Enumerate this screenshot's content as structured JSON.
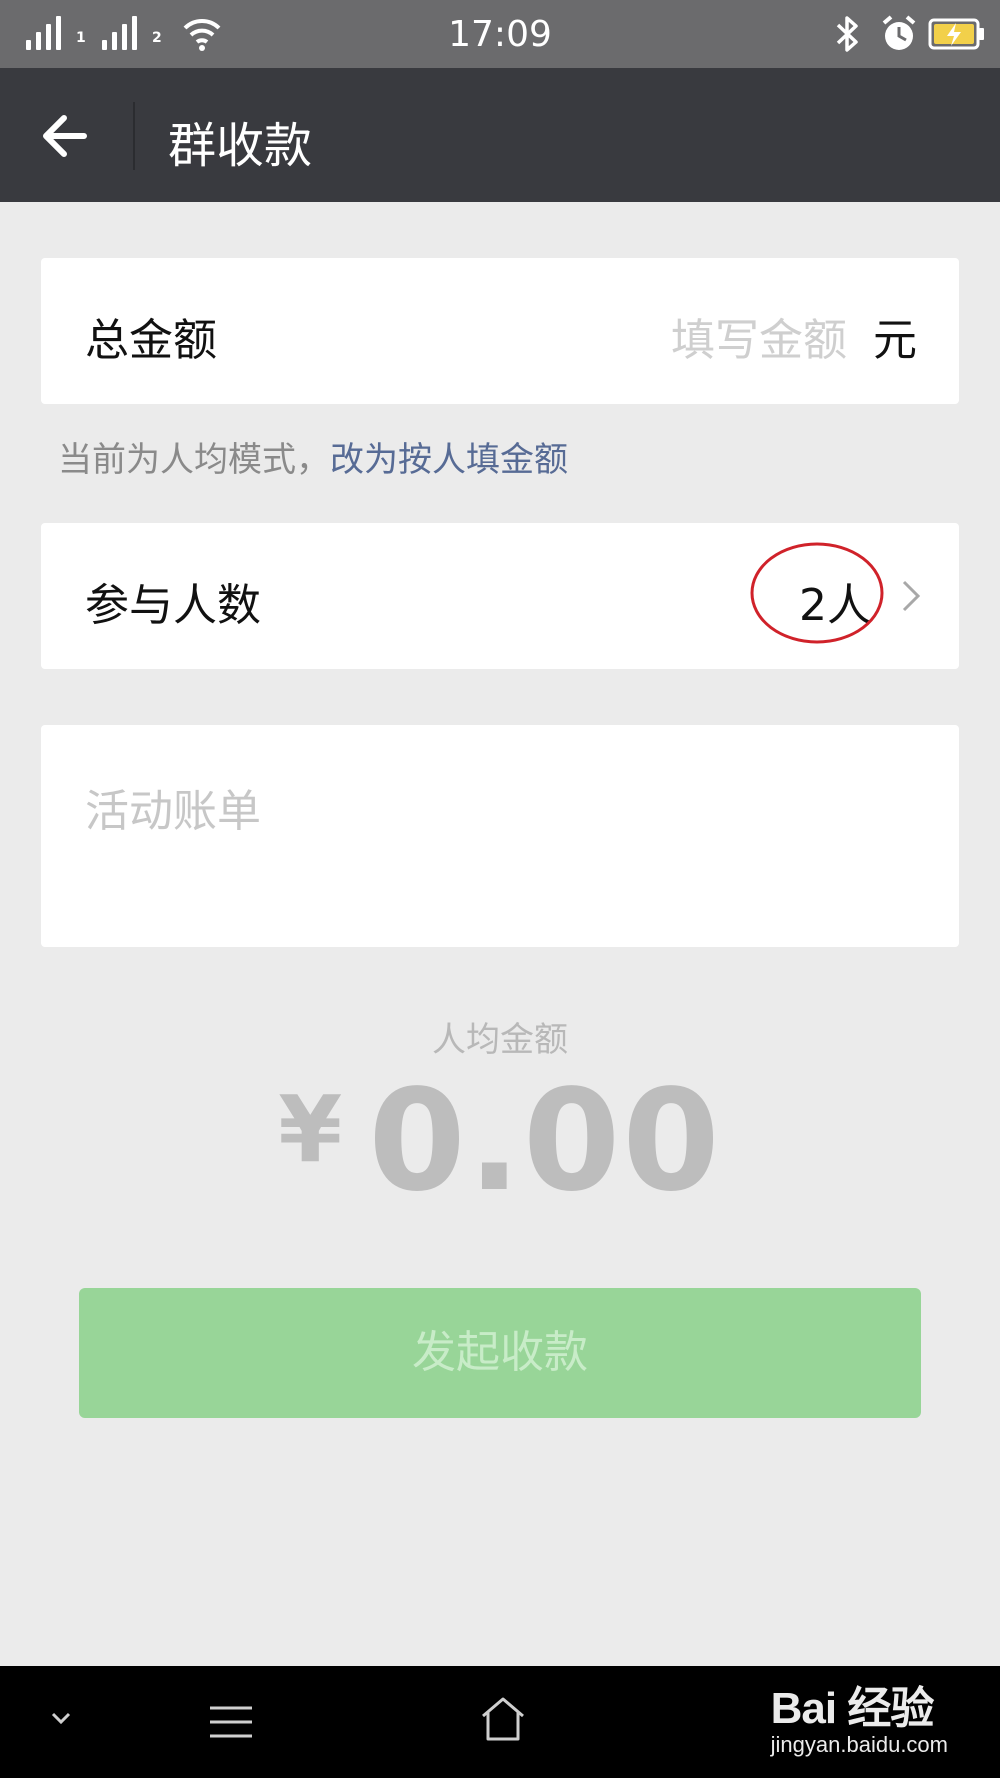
{
  "status_bar": {
    "time": "17:09",
    "sim1_label": "1",
    "sim2_label": "2",
    "icons": [
      "signal-icon",
      "wifi-icon",
      "bluetooth-icon",
      "alarm-icon",
      "battery-charging-icon"
    ]
  },
  "header": {
    "title": "群收款",
    "back_icon": "arrow-left-icon"
  },
  "total_amount": {
    "label": "总金额",
    "placeholder": "填写金额",
    "unit": "元"
  },
  "mode_hint": {
    "text": "当前为人均模式，",
    "link": "改为按人填金额"
  },
  "participants": {
    "label": "参与人数",
    "value": "2人"
  },
  "note": {
    "placeholder": "活动账单"
  },
  "average": {
    "label": "人均金额",
    "currency": "¥",
    "amount": "0.00"
  },
  "submit": {
    "label": "发起收款"
  },
  "watermark": {
    "brand": "Bai 经验",
    "url": "jingyan.baidu.com"
  },
  "colors": {
    "header_bg": "#393a3f",
    "page_bg": "#ebebeb",
    "link": "#576b95",
    "button_disabled": "#98d598",
    "annotation_circle": "#d0222a"
  }
}
